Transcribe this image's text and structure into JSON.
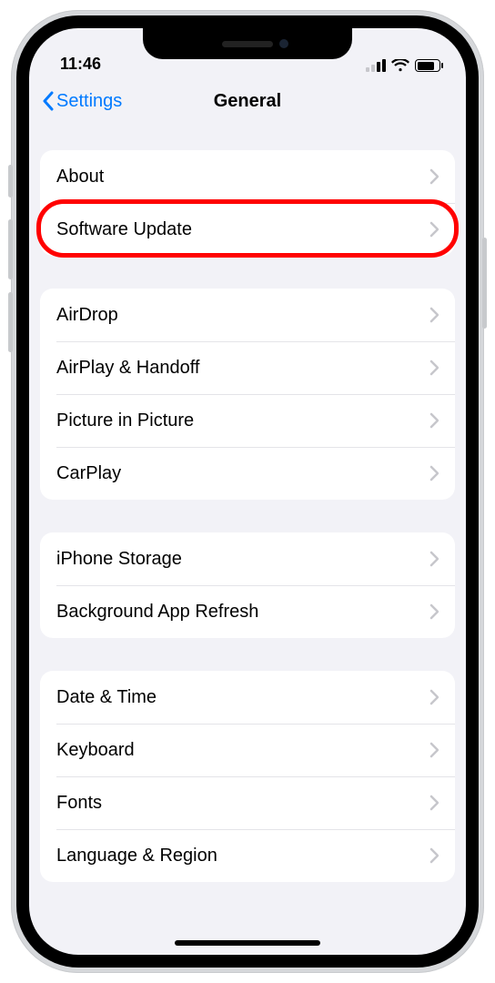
{
  "status": {
    "time": "11:46"
  },
  "nav": {
    "back_label": "Settings",
    "title": "General"
  },
  "groups": [
    {
      "rows": [
        {
          "label": "About",
          "key": "about"
        },
        {
          "label": "Software Update",
          "key": "software-update",
          "highlighted": true
        }
      ]
    },
    {
      "rows": [
        {
          "label": "AirDrop",
          "key": "airdrop"
        },
        {
          "label": "AirPlay & Handoff",
          "key": "airplay-handoff"
        },
        {
          "label": "Picture in Picture",
          "key": "picture-in-picture"
        },
        {
          "label": "CarPlay",
          "key": "carplay"
        }
      ]
    },
    {
      "rows": [
        {
          "label": "iPhone Storage",
          "key": "iphone-storage"
        },
        {
          "label": "Background App Refresh",
          "key": "background-app-refresh"
        }
      ]
    },
    {
      "rows": [
        {
          "label": "Date & Time",
          "key": "date-time"
        },
        {
          "label": "Keyboard",
          "key": "keyboard"
        },
        {
          "label": "Fonts",
          "key": "fonts"
        },
        {
          "label": "Language & Region",
          "key": "language-region"
        }
      ]
    }
  ],
  "highlight_color": "#ff0000"
}
